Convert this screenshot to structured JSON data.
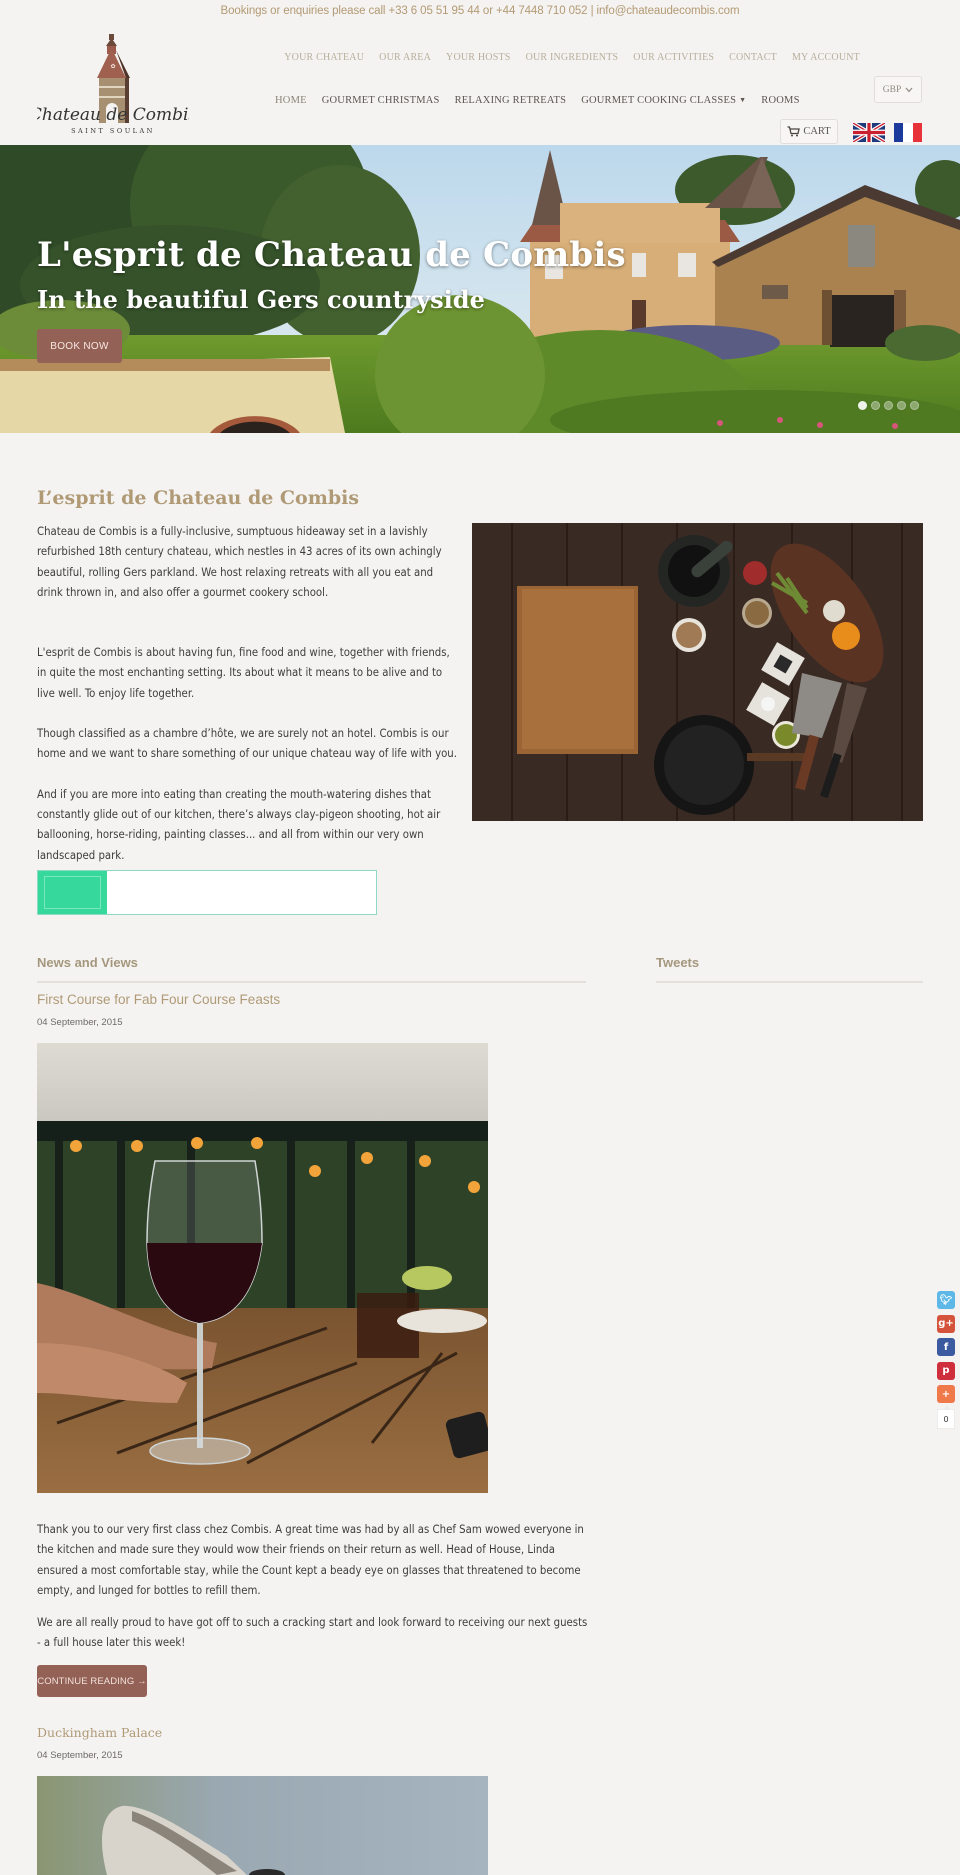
{
  "topbar": {
    "text": "Bookings or enquiries please call +33 6 05 51 95 44 or +44 7448 710 052 | info@chateaudecombis.com"
  },
  "logo": {
    "name": "Chateau de Combis",
    "tagline": "SAINT SOULAN"
  },
  "nav_secondary": [
    {
      "label": "YOUR CHATEAU"
    },
    {
      "label": "OUR AREA"
    },
    {
      "label": "YOUR HOSTS"
    },
    {
      "label": "OUR INGREDIENTS"
    },
    {
      "label": "OUR ACTIVITIES"
    },
    {
      "label": "CONTACT"
    },
    {
      "label": "MY ACCOUNT"
    }
  ],
  "currency": {
    "selected": "GBP"
  },
  "nav_primary": [
    {
      "label": "HOME"
    },
    {
      "label": "GOURMET CHRISTMAS"
    },
    {
      "label": "RELAXING RETREATS"
    },
    {
      "label": "GOURMET COOKING CLASSES",
      "has_dropdown": true
    },
    {
      "label": "ROOMS"
    }
  ],
  "cart": {
    "label": "CART"
  },
  "languages": [
    {
      "code": "en",
      "icon": "uk-flag-icon"
    },
    {
      "code": "fr",
      "icon": "france-flag-icon"
    }
  ],
  "hero": {
    "title": "L'esprit de Chateau de Combis",
    "subtitle": "In the beautiful Gers countryside",
    "cta": "BOOK NOW",
    "slides": 5,
    "active_slide": 1
  },
  "intro": {
    "title": "L’esprit de Chateau de Combis",
    "paragraphs": [
      "Chateau de Combis is a fully-inclusive, sumptuous hideaway set in a lavishly refurbished 18th century chateau, which nestles in 43 acres of its own achingly beautiful, rolling Gers parkland. We host relaxing retreats with all you eat and drink thrown in, and also offer a gourmet cookery school.",
      "L'esprit de Combis is about having fun, fine food and wine, together with friends, in quite the most enchanting setting. Its about what it means to be alive and to live well. To enjoy life together.",
      "Though classified as a chambre d’hôte, we are surely not an hotel. Combis is our home and we want to share something of our unique chateau way of life with you.",
      "And if you are more into eating than creating the mouth-watering dishes that constantly glide out of our kitchen, there’s always clay-pigeon shooting, hot air ballooning, horse-riding, painting classes... and all from within our very own landscaped park."
    ]
  },
  "news": {
    "title": "News and Views",
    "posts": [
      {
        "title": "First Course for Fab Four Course Feasts",
        "date": "04 September, 2015",
        "paragraphs": [
          "Thank you to our very first class chez Combis. A great time was had by all as Chef Sam wowed everyone in the kitchen and made sure they would wow their friends on their return as well. Head of House, Linda ensured a most comfortable stay, while the Count kept a beady eye on glasses that threatened to become empty, and lunged for bottles to refill them.",
          "We are all really proud to have got off to such a cracking start and look forward to receiving our next guests - a full house later this week!"
        ],
        "cta": "CONTINUE READING →"
      },
      {
        "title": "Duckingham Palace",
        "date": "04 September, 2015"
      }
    ]
  },
  "tweets": {
    "title": "Tweets"
  },
  "share": {
    "buttons": [
      {
        "name": "twitter",
        "glyph": "t",
        "color": "#5db8e8"
      },
      {
        "name": "google-plus",
        "glyph": "g+",
        "color": "#d5533a"
      },
      {
        "name": "facebook",
        "glyph": "f",
        "color": "#3c5a9f"
      },
      {
        "name": "pinterest",
        "glyph": "p",
        "color": "#cf2e3d"
      },
      {
        "name": "more",
        "glyph": "+",
        "color": "#f0794a"
      }
    ],
    "count": "0"
  }
}
